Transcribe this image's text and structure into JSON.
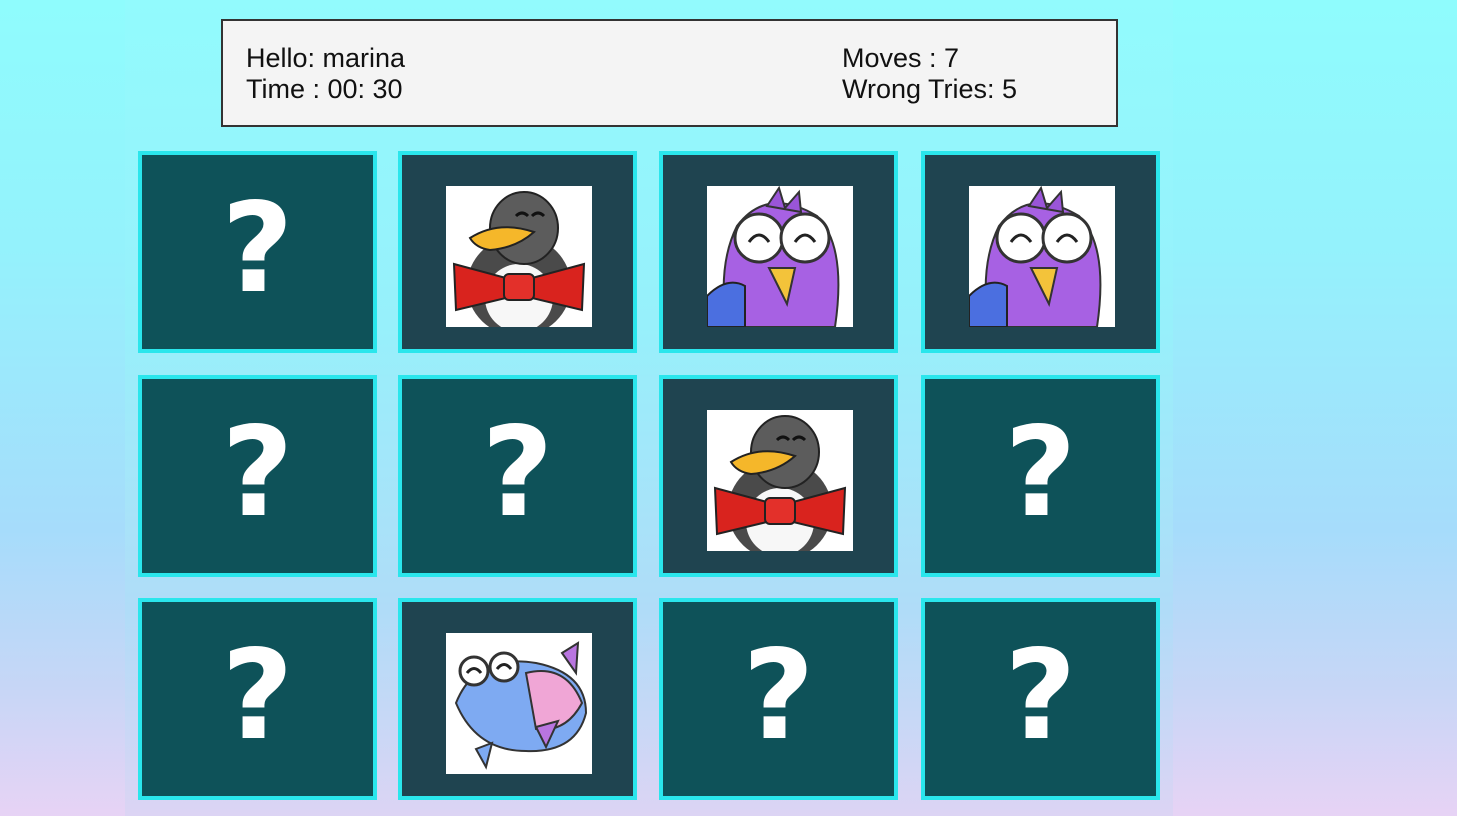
{
  "status": {
    "greeting": "Hello: marina",
    "time": "Time : 00: 30",
    "moves": "Moves : 7",
    "wrong_tries": "Wrong Tries: 5"
  },
  "cards": [
    {
      "state": "hidden",
      "symbol": "?"
    },
    {
      "state": "revealed",
      "icon": "penguin-icon"
    },
    {
      "state": "revealed",
      "icon": "bird-icon"
    },
    {
      "state": "revealed",
      "icon": "bird-icon"
    },
    {
      "state": "hidden",
      "symbol": "?"
    },
    {
      "state": "hidden",
      "symbol": "?"
    },
    {
      "state": "revealed",
      "icon": "penguin-icon"
    },
    {
      "state": "hidden",
      "symbol": "?"
    },
    {
      "state": "hidden",
      "symbol": "?"
    },
    {
      "state": "revealed",
      "icon": "fish-icon"
    },
    {
      "state": "hidden",
      "symbol": "?"
    },
    {
      "state": "hidden",
      "symbol": "?"
    }
  ],
  "colors": {
    "card_back": "#0e5259",
    "card_face": "#1f4450",
    "card_border": "#2ae6ec",
    "background_top": "#8ffcfd",
    "background_bottom": "#e7d3f5"
  }
}
